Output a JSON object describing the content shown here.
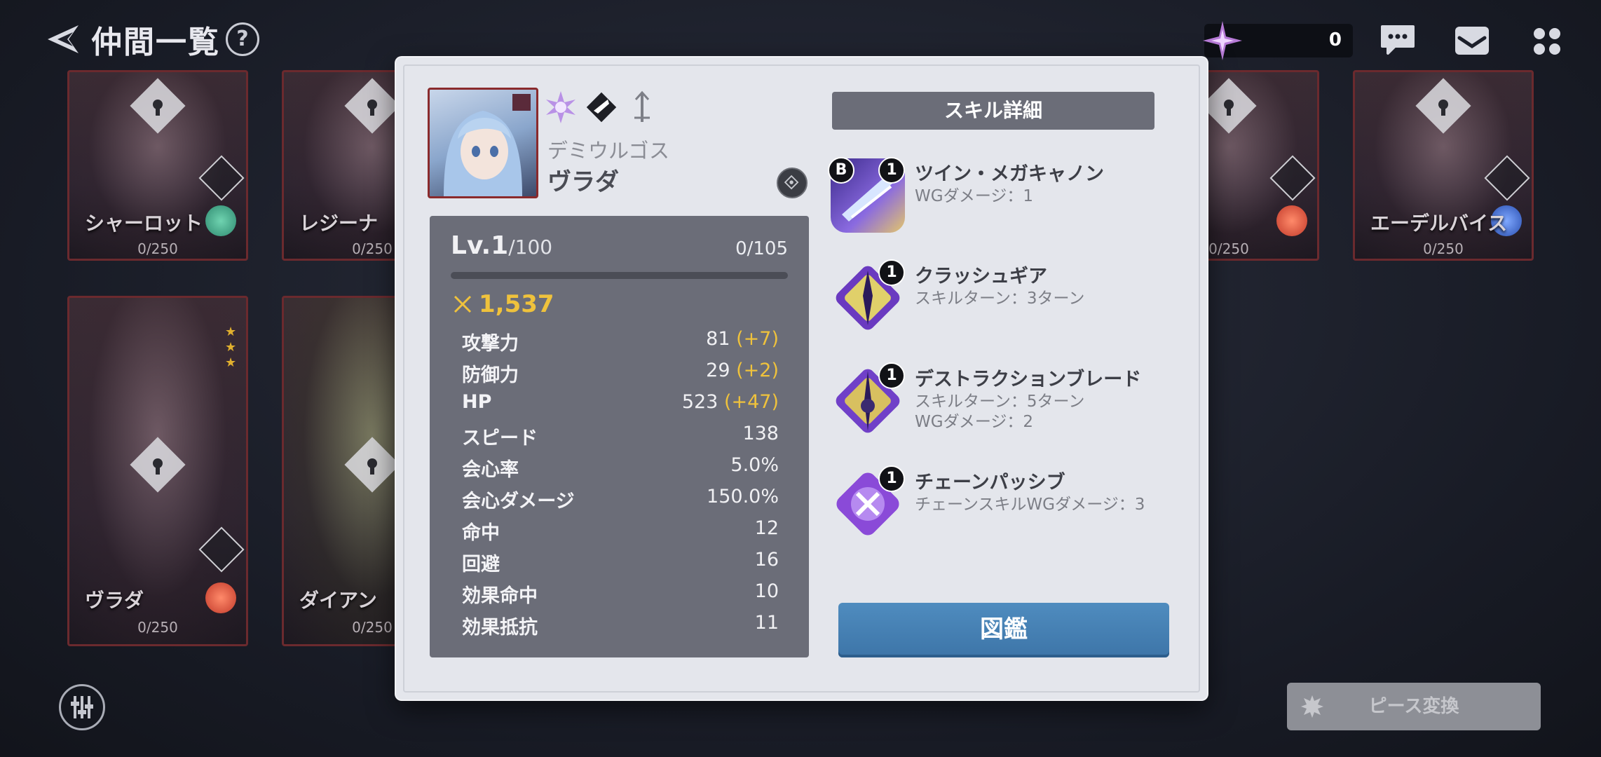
{
  "header": {
    "title": "仲間一覧",
    "help": "?",
    "currency_value": "0"
  },
  "cards": [
    {
      "name": "シャーロット",
      "count": "0/250",
      "element": "wind"
    },
    {
      "name": "レジーナ",
      "count": "0/250"
    },
    {
      "name": "",
      "count": "0/250",
      "element": "fire"
    },
    {
      "name": "エーデルバイス",
      "count": "0/250",
      "element": "water"
    },
    {
      "name": "ヴラダ",
      "count": "0/250",
      "element": "fire"
    },
    {
      "name": "ダイアン",
      "count": "0/250"
    }
  ],
  "bottom": {
    "piece_convert": "ピース変換"
  },
  "modal": {
    "race": "デミウルゴス",
    "name": "ヴラダ",
    "level": "Lv.1",
    "level_max": "/100",
    "exp": "0/105",
    "exp_fraction": 0,
    "power": "1,537",
    "stats": [
      {
        "label": "攻撃力",
        "value": "81",
        "bonus": "(+7)"
      },
      {
        "label": "防御力",
        "value": "29",
        "bonus": "(+2)"
      },
      {
        "label": "HP",
        "value": "523",
        "bonus": "(+47)"
      },
      {
        "label": "スピード",
        "value": "138",
        "bonus": ""
      },
      {
        "label": "会心率",
        "value": "5.0%",
        "bonus": ""
      },
      {
        "label": "会心ダメージ",
        "value": "150.0%",
        "bonus": ""
      },
      {
        "label": "命中",
        "value": "12",
        "bonus": ""
      },
      {
        "label": "回避",
        "value": "16",
        "bonus": ""
      },
      {
        "label": "効果命中",
        "value": "10",
        "bonus": ""
      },
      {
        "label": "効果抵抗",
        "value": "11",
        "bonus": ""
      }
    ],
    "skill_header": "スキル詳細",
    "skills": [
      {
        "badge_b": "B",
        "level": "1",
        "name": "ツイン・メガキャノン",
        "desc": [
          "WGダメージ：1"
        ]
      },
      {
        "badge_b": "",
        "level": "1",
        "name": "クラッシュギア",
        "desc": [
          "スキルターン：3ターン"
        ]
      },
      {
        "badge_b": "",
        "level": "1",
        "name": "デストラクションブレード",
        "desc": [
          "スキルターン：5ターン",
          "WGダメージ：2"
        ]
      },
      {
        "badge_b": "",
        "level": "1",
        "name": "チェーンパッシブ",
        "desc": [
          "チェーンスキルWGダメージ：3"
        ]
      }
    ],
    "zukan_button": "図鑑"
  },
  "colors": {
    "accent_gold": "#efc23c",
    "button_blue": "#3d75a8",
    "panel_gray": "#6b6d78",
    "modal_bg": "#e4e6ec"
  }
}
